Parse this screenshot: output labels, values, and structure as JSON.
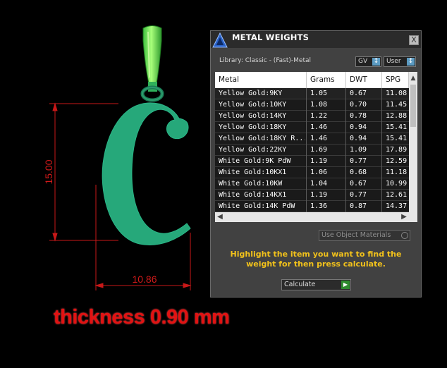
{
  "viewport": {
    "dimension_height": "15.00",
    "dimension_width": "10.86",
    "thickness_label": "thickness 0.90 mm"
  },
  "panel": {
    "title": "METAL WEIGHTS",
    "close_label": "X",
    "logo_icon": "app-logo-icon",
    "library_label": "Library: Classic - (Fast)-Metal",
    "gv_label": "GV",
    "user_label": "User",
    "columns": [
      "Metal",
      "Grams",
      "DWT",
      "SPG"
    ],
    "rows": [
      {
        "metal": "Yellow Gold:9KY",
        "grams": "1.05",
        "dwt": "0.67",
        "spg": "11.08"
      },
      {
        "metal": "Yellow Gold:10KY",
        "grams": "1.08",
        "dwt": "0.70",
        "spg": "11.45"
      },
      {
        "metal": "Yellow Gold:14KY",
        "grams": "1.22",
        "dwt": "0.78",
        "spg": "12.88"
      },
      {
        "metal": "Yellow Gold:18KY",
        "grams": "1.46",
        "dwt": "0.94",
        "spg": "15.41"
      },
      {
        "metal": "Yellow Gold:18KY R...",
        "grams": "1.46",
        "dwt": "0.94",
        "spg": "15.41"
      },
      {
        "metal": "Yellow Gold:22KY",
        "grams": "1.69",
        "dwt": "1.09",
        "spg": "17.89"
      },
      {
        "metal": "White Gold:9K PdW",
        "grams": "1.19",
        "dwt": "0.77",
        "spg": "12.59"
      },
      {
        "metal": "White Gold:10KX1",
        "grams": "1.06",
        "dwt": "0.68",
        "spg": "11.18"
      },
      {
        "metal": "White Gold:10KW",
        "grams": "1.04",
        "dwt": "0.67",
        "spg": "10.99"
      },
      {
        "metal": "White Gold:14KX1",
        "grams": "1.19",
        "dwt": "0.77",
        "spg": "12.61"
      },
      {
        "metal": "White Gold:14K PdW",
        "grams": "1.36",
        "dwt": "0.87",
        "spg": "14.37"
      }
    ],
    "use_object_materials_label": "Use Object Materials",
    "hint_text": "Highlight the item you want to find the weight for then press calculate.",
    "calculate_label": "Calculate"
  }
}
